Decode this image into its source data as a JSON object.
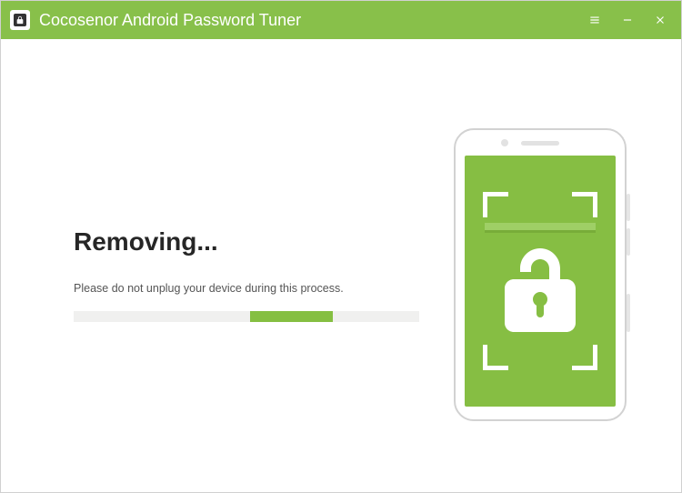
{
  "colors": {
    "brand": "#88c04a",
    "brand_dark": "#85bf41",
    "screen": "#86be43",
    "track": "#f0f0ef"
  },
  "titlebar": {
    "app_title": "Cocosenor Android Password Tuner"
  },
  "main": {
    "heading": "Removing...",
    "subtext": "Please do not unplug your device during this process.",
    "progress": {
      "start_pct": 51,
      "width_pct": 24
    }
  }
}
